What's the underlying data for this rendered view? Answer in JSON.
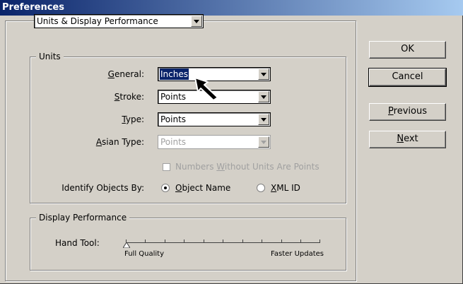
{
  "window": {
    "title": "Preferences"
  },
  "section_select": {
    "value": "Units & Display Performance"
  },
  "units": {
    "legend": "Units",
    "general": {
      "label_pre": "",
      "label_acc": "G",
      "label_post": "eneral:",
      "value": "Inches"
    },
    "stroke": {
      "label_pre": "",
      "label_acc": "S",
      "label_post": "troke:",
      "value": "Points"
    },
    "type": {
      "label_pre": "",
      "label_acc": "T",
      "label_post": "ype:",
      "value": "Points"
    },
    "asian_type": {
      "label_pre": "",
      "label_acc": "A",
      "label_post": "sian Type:",
      "value": "Points"
    },
    "numbers_checkbox": {
      "pre": "Numbers ",
      "acc": "W",
      "post": "ithout Units Are Points",
      "checked": false
    },
    "identify_label": "Identify Objects By:",
    "object_name": {
      "pre": "",
      "acc": "O",
      "post": "bject Name",
      "selected": true
    },
    "xml_id": {
      "pre": "",
      "acc": "X",
      "post": "ML ID",
      "selected": false
    }
  },
  "display": {
    "legend": "Display Performance",
    "hand_tool_label": "Hand Tool:",
    "min_label": "Full Quality",
    "max_label": "Faster Updates",
    "position": 0
  },
  "buttons": {
    "ok": "OK",
    "cancel": "Cancel",
    "previous": {
      "pre": "",
      "acc": "P",
      "post": "revious"
    },
    "next": {
      "pre": "",
      "acc": "N",
      "post": "ext"
    }
  }
}
